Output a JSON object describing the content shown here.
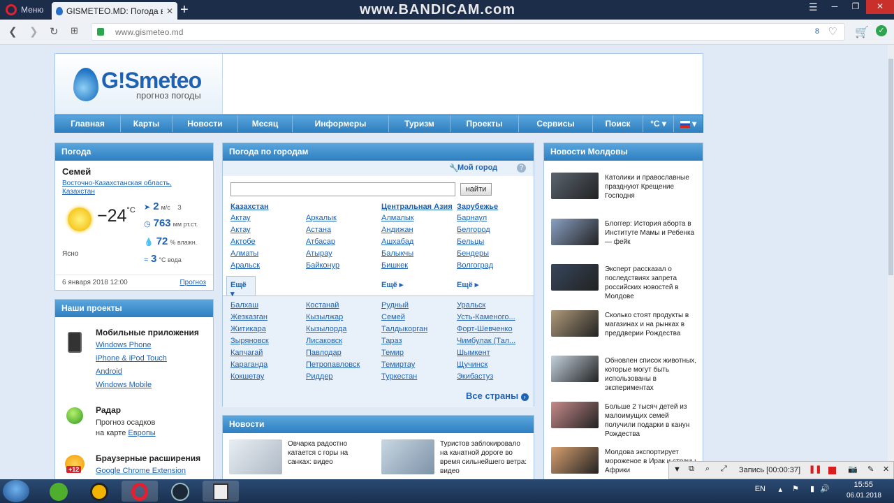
{
  "browser": {
    "menu_label": "Меню",
    "tab_title": "GISMETEO.MD: Погода в",
    "tab_close": "✕",
    "new_tab": "+",
    "url": "www.gismeteo.md",
    "ext_count": "8",
    "watermark": "www.BANDICAM.com"
  },
  "site": {
    "logo_name": "G!Smeteo",
    "logo_tagline": "прогноз погоды",
    "menu": [
      "Главная",
      "Карты",
      "Новости",
      "Месяц",
      "Информеры",
      "Туризм",
      "Проекты",
      "Сервисы",
      "Поиск",
      "°C ▾",
      "▾"
    ]
  },
  "weather": {
    "header": "Погода",
    "city": "Семей",
    "region": "Восточно-Казахстанская область, Казахстан",
    "temp": "−24",
    "temp_unit": "°C",
    "condition": "Ясно",
    "wind_value": "2",
    "wind_unit": "м/с",
    "wind_dir": "З",
    "pressure_value": "763",
    "pressure_unit": "мм рт.ст.",
    "humidity_value": "72",
    "humidity_unit": "% влажн.",
    "water_value": "3",
    "water_unit": "°C вода",
    "date": "6 января 2018 12:00",
    "forecast_link": "Прогноз"
  },
  "projects": {
    "header": "Наши проекты",
    "mobile_title": "Мобильные приложения",
    "mobile_links": [
      "Windows Phone",
      "iPhone & iPod Touch",
      "Android",
      "Windows Mobile"
    ],
    "radar_title": "Радар",
    "radar_text1": "Прогноз осадков",
    "radar_text2": "на карте",
    "radar_link": "Европы",
    "ext_title": "Браузерные расширения",
    "ext_link": "Google Chrome Extension",
    "ext_badge": "+12"
  },
  "cities": {
    "header": "Погода по городам",
    "my_city": "Мой город",
    "help": "?",
    "search_button": "найти",
    "col_heads": [
      "Казахстан",
      "Центральная Азия",
      "Зарубежье"
    ],
    "col1": [
      "Актау",
      "Актау",
      "Актобе",
      "Алматы",
      "Аральск"
    ],
    "col2": [
      "Аркалык",
      "Астана",
      "Атбасар",
      "Атырау",
      "Байконур"
    ],
    "col3": [
      "Алмалык",
      "Андижан",
      "Ашхабад",
      "Балыкчы",
      "Бишкек"
    ],
    "col4": [
      "Барнаул",
      "Белгород",
      "Бельцы",
      "Бендеры",
      "Волгоград"
    ],
    "more": "Ещё ▾",
    "more_right": "Ещё ▸",
    "ex1": [
      "Балхаш",
      "Жезказган",
      "Житикара",
      "Зыряновск",
      "Капчагай",
      "Караганда",
      "Кокшетау"
    ],
    "ex2": [
      "Костанай",
      "Кызылжар",
      "Кызылорда",
      "Лисаковск",
      "Павлодар",
      "Петропавловск",
      "Риддер"
    ],
    "ex3": [
      "Рудный",
      "Семей",
      "Талдыкорган",
      "Тараз",
      "Темир",
      "Темиртау",
      "Туркестан"
    ],
    "ex4": [
      "Уральск",
      "Усть-Каменого...",
      "Форт-Шевченко",
      "Чимбулак (Тал...",
      "Шымкент",
      "Щучинск",
      "Экибастуз"
    ],
    "all_countries": "Все страны"
  },
  "news": {
    "header": "Новости",
    "items": [
      "Овчарка радостно катается с горы на санках: видео",
      "Туристов заблокировало на канатной дороге во время сильнейшего ветра: видео"
    ]
  },
  "moldova": {
    "header": "Новости Молдовы",
    "items": [
      "Католики и православные празднуют Крещение Господня",
      "Блоггер: История аборта в Институте Мамы и Ребенка — фейк",
      "Эксперт рассказал о последствиях запрета российских новостей в Молдове",
      "Сколько стоят продукты в магазинах и на рынках в преддверии Рождества",
      "Обновлен список животных, которые могут быть использованы в экспериментах",
      "Больше 2 тысяч детей из малоимущих семей получили подарки в канун Рождества",
      "Молдова экспортирует мороженое в Ирак и страны Африки"
    ]
  },
  "recorder": {
    "label": "Запись [00:00:37]"
  },
  "tray": {
    "lang": "EN",
    "time": "15:55",
    "date": "06.01.2018"
  }
}
